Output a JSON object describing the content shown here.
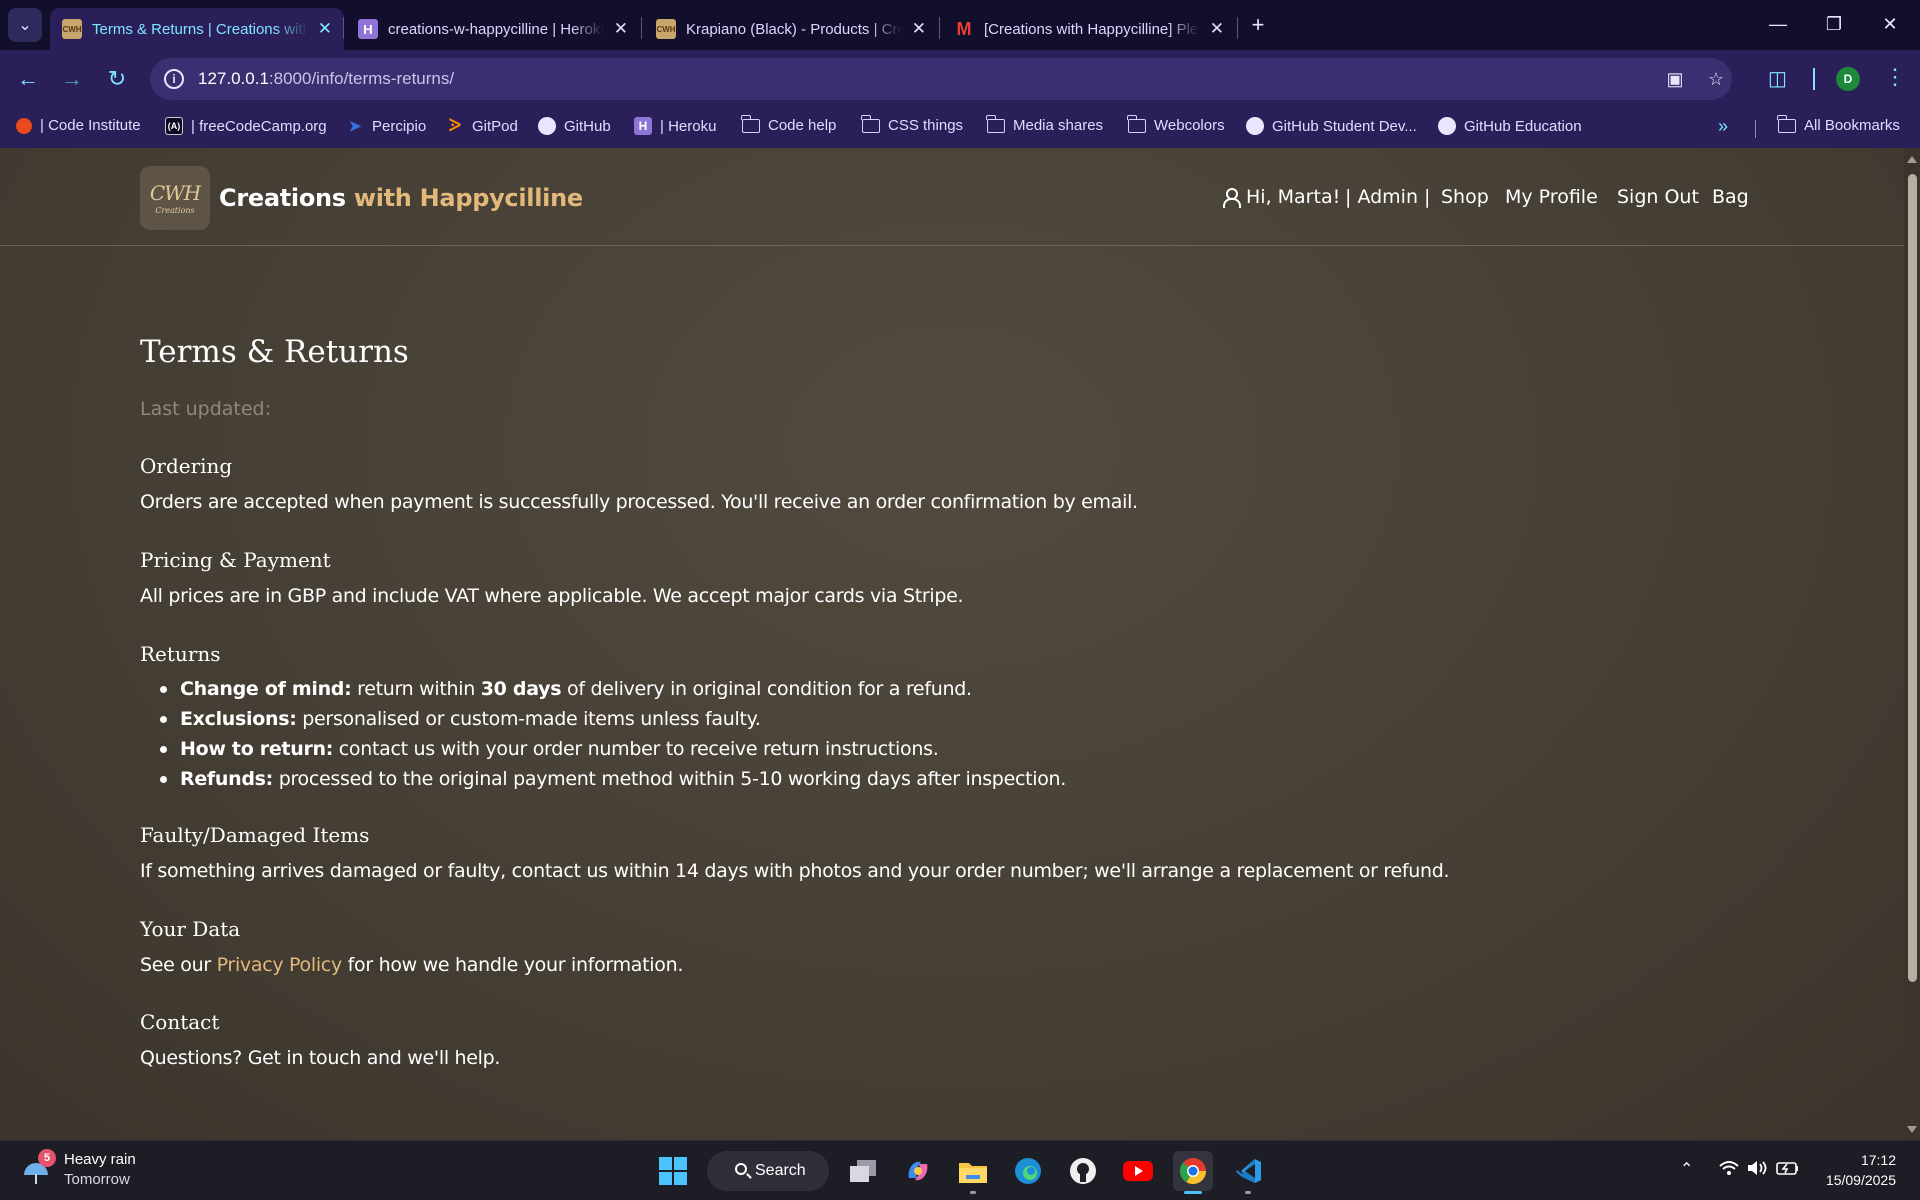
{
  "browser": {
    "tabs": [
      {
        "title": "Terms & Returns | Creations with Happycilline",
        "favicon": "cwh-favicon",
        "active": true
      },
      {
        "title": "creations-w-happycilline | Heroku",
        "favicon": "heroku-favicon",
        "active": false
      },
      {
        "title": "Krapiano (Black) - Products | Creations with Happycilline",
        "favicon": "cwh-favicon",
        "active": false
      },
      {
        "title": "[Creations with Happycilline] Please Confirm",
        "favicon": "gmail-favicon",
        "active": false
      }
    ],
    "url_host": "127.0.0.1",
    "url_path": ":8000/info/terms-returns/",
    "profile_initial": "D",
    "bookmarks": [
      {
        "label": "| Code Institute",
        "icon": "code-institute-icon"
      },
      {
        "label": "| freeCodeCamp.org",
        "icon": "freecodecamp-icon"
      },
      {
        "label": "Percipio",
        "icon": "percipio-icon"
      },
      {
        "label": "GitPod",
        "icon": "gitpod-icon"
      },
      {
        "label": "GitHub",
        "icon": "github-icon"
      },
      {
        "label": "| Heroku",
        "icon": "heroku-icon"
      },
      {
        "label": "Code help",
        "icon": "folder-icon"
      },
      {
        "label": "CSS things",
        "icon": "folder-icon"
      },
      {
        "label": "Media shares",
        "icon": "folder-icon"
      },
      {
        "label": "Webcolors",
        "icon": "folder-icon"
      },
      {
        "label": "GitHub Student Dev...",
        "icon": "github-icon"
      },
      {
        "label": "GitHub Education",
        "icon": "github-icon"
      }
    ],
    "all_bookmarks": "All Bookmarks"
  },
  "site": {
    "brand_main": "Creations",
    "brand_accent": " with Happycilline",
    "logo_mono": "CWH",
    "logo_script": "Creations",
    "nav": {
      "greeting": "Hi, Marta!",
      "admin": "| Admin |",
      "shop": "Shop",
      "profile": "My Profile",
      "signout": "Sign Out",
      "bag": "Bag"
    },
    "accent_color": "#e2b97a"
  },
  "page": {
    "title": "Terms & Returns",
    "last_updated": "Last updated:",
    "ordering": {
      "heading": "Ordering",
      "text": "Orders are accepted when payment is successfully processed. You'll receive an order confirmation by email."
    },
    "pricing": {
      "heading": "Pricing & Payment",
      "text": "All prices are in GBP and include VAT where applicable. We accept major cards via Stripe."
    },
    "returns": {
      "heading": "Returns",
      "items": [
        {
          "bold": "Change of mind:",
          "text_a": " return within ",
          "bold2": "30 days",
          "text_b": " of delivery in original condition for a refund."
        },
        {
          "bold": "Exclusions:",
          "text_a": " personalised or custom-made items unless faulty."
        },
        {
          "bold": "How to return:",
          "text_a": " contact us with your order number to receive return instructions."
        },
        {
          "bold": "Refunds:",
          "text_a": " processed to the original payment method within 5-10 working days after inspection."
        }
      ]
    },
    "faulty": {
      "heading": "Faulty/Damaged Items",
      "text": "If something arrives damaged or faulty, contact us within 14 days with photos and your order number; we'll arrange a replacement or refund."
    },
    "data": {
      "heading": "Your Data",
      "text_before": "See our ",
      "link": "Privacy Policy",
      "text_after": " for how we handle your information."
    },
    "contact": {
      "heading": "Contact",
      "text": "Questions? Get in touch and we'll help."
    }
  },
  "taskbar": {
    "weather_badge": "5",
    "weather_line1": "Heavy rain",
    "weather_line2": "Tomorrow",
    "search_label": "Search",
    "time": "17:12",
    "date": "15/09/2025"
  }
}
